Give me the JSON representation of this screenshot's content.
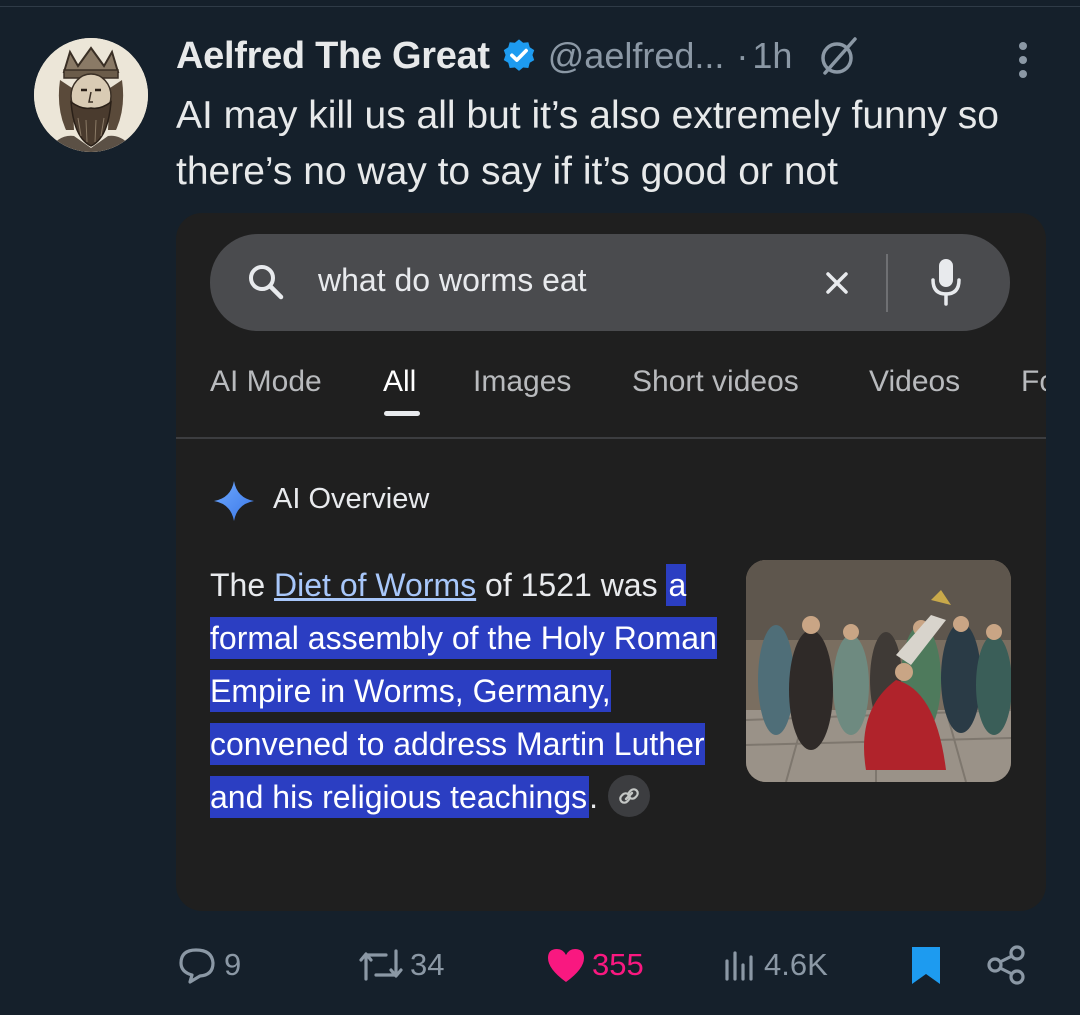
{
  "tweet": {
    "display_name": "Aelfred The Great",
    "handle": "@aelfred...",
    "separator": "·",
    "time": "1h",
    "text": "AI may kill us all but it’s also extremely funny so there’s no way to say if it’s good or not"
  },
  "embedded": {
    "search": {
      "query": "what do worms eat"
    },
    "tabs": [
      {
        "label": "AI Mode",
        "active": false
      },
      {
        "label": "All",
        "active": true
      },
      {
        "label": "Images",
        "active": false
      },
      {
        "label": "Short videos",
        "active": false
      },
      {
        "label": "Videos",
        "active": false
      },
      {
        "label": "Fc",
        "active": false
      }
    ],
    "overview_title": "AI Overview",
    "answer": {
      "prefix": "The ",
      "link_text": "Diet of Worms",
      "mid": " of 1521 was ",
      "highlighted": "a formal assembly of the Holy Roman Empire in Worms, Germany, convened to address Martin Luther and his religious teachings",
      "suffix": "."
    }
  },
  "actions": {
    "replies": "9",
    "reposts": "34",
    "likes": "355",
    "views": "4.6K"
  },
  "colors": {
    "background": "#15202b",
    "like_pink": "#f91880",
    "bookmark_blue": "#1d9bf0",
    "verified_blue": "#1d9bf0",
    "highlight": "#2b3ec2",
    "link": "#a8c7fa"
  },
  "icons": [
    "verified-badge-icon",
    "grok-icon",
    "more-icon",
    "search-icon",
    "clear-icon",
    "mic-icon",
    "ai-sparkle-icon",
    "link-icon",
    "reply-icon",
    "repost-icon",
    "like-icon",
    "views-icon",
    "bookmark-icon",
    "share-icon"
  ]
}
